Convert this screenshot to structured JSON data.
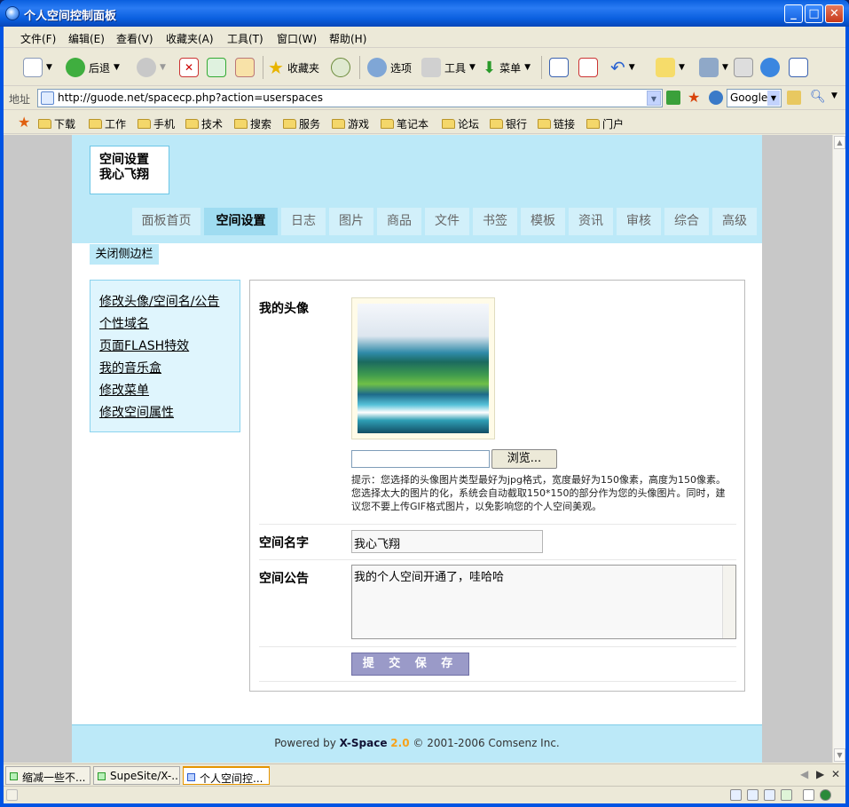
{
  "window": {
    "title": "个人空间控制面板"
  },
  "menu": [
    "文件(F)",
    "编辑(E)",
    "查看(V)",
    "收藏夹(A)",
    "工具(T)",
    "窗口(W)",
    "帮助(H)"
  ],
  "toolbar": {
    "back": "后退",
    "favorites": "收藏夹",
    "options": "选项",
    "tools": "工具",
    "menu": "菜单"
  },
  "address": {
    "label": "地址",
    "url": "http://guode.net/spacecp.php?action=userspaces",
    "search_engine": "Google"
  },
  "bookmarks": [
    "下载",
    "工作",
    "手机",
    "技术",
    "搜索",
    "服务",
    "游戏",
    "笔记本",
    "论坛",
    "银行",
    "链接",
    "门户"
  ],
  "site": {
    "logo_line1": "空间设置",
    "logo_line2": "我心飞翔",
    "nav": [
      "面板首页",
      "空间设置",
      "日志",
      "图片",
      "商品",
      "文件",
      "书签",
      "模板",
      "资讯",
      "审核",
      "综合",
      "高级"
    ],
    "close_sidebar": "关闭侧边栏",
    "sidebar_links": [
      "修改头像/空间名/公告",
      "个性域名",
      "页面FLASH特效",
      "我的音乐盒",
      "修改菜单",
      "修改空间属性"
    ]
  },
  "form": {
    "avatar_label": "我的头像",
    "browse_label": "浏览...",
    "hint": "提示：您选择的头像图片类型最好为jpg格式，宽度最好为150像素，高度为150像素。您选择太大的图片的化，系统会自动截取150*150的部分作为您的头像图片。同时，建议您不要上传GIF格式图片，以免影响您的个人空间美观。",
    "name_label": "空间名字",
    "name_value": "我心飞翔",
    "notice_label": "空间公告",
    "notice_value": "我的个人空间开通了，哇哈哈",
    "submit_label": "提 交 保 存"
  },
  "footer": {
    "prefix": "Powered by ",
    "brand": "X-Space",
    "version": "2.0",
    "suffix": " © 2001-2006 Comsenz Inc."
  },
  "tabs": [
    "缩减一些不...",
    "SupeSite/X-...",
    "个人空间控..."
  ]
}
